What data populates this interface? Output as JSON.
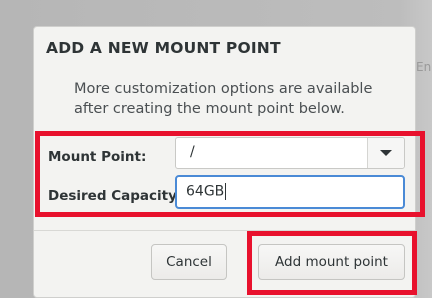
{
  "backdrop": {
    "glimpse_text": "En"
  },
  "dialog": {
    "title": "ADD A NEW MOUNT POINT",
    "description": "More customization options are available after creating the mount point below."
  },
  "form": {
    "mount_point_label": "Mount Point:",
    "mount_point_value": "/",
    "capacity_label": "Desired Capacity:",
    "capacity_value": "64GB"
  },
  "buttons": {
    "cancel_label": "Cancel",
    "add_label": "Add mount point"
  },
  "colors": {
    "highlight": "#e8112d",
    "focus": "#4a8ad6"
  }
}
